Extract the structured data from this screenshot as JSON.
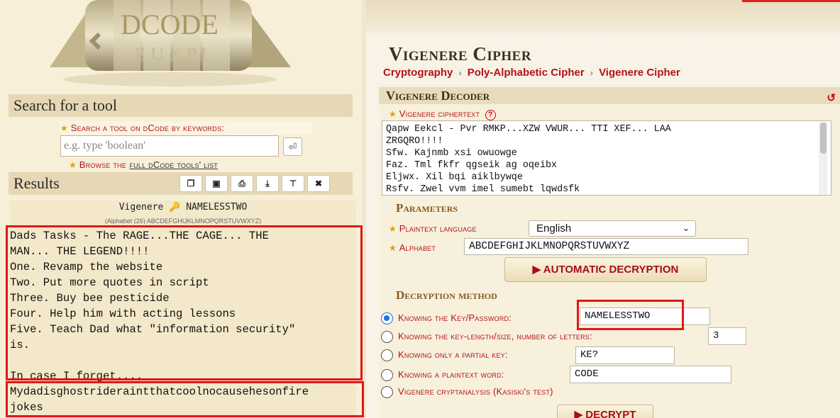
{
  "logo": {
    "text": "DCODE"
  },
  "search": {
    "heading": "Search for a tool",
    "label": "Search a tool on dCode by keywords:",
    "placeholder": "e.g. type 'boolean'",
    "browse_prefix": "Browse the",
    "browse_link": "full dCode tools' list"
  },
  "results": {
    "heading": "Results",
    "buttons": [
      "copy-icon",
      "save-icon",
      "print-icon",
      "download-icon",
      "pin-icon",
      "close-icon"
    ],
    "title_method": "Vigenere",
    "title_key": "NAMELESSTWO",
    "subtitle": "(Alphabet (26) ABCDEFGHIJKLMNOPQRSTUVWXYZ)",
    "text_lines": [
      "Dads Tasks - The RAGE...THE CAGE... THE",
      "MAN... THE LEGEND!!!!",
      "One. Revamp the website",
      "Two. Put more quotes in script",
      "Three. Buy bee pesticide",
      "Four. Help him with acting lessons",
      "Five. Teach Dad what \"information security\"",
      "is.",
      "",
      "In case I forget....",
      "Mydadisghostrideraintthatcoolnocausehesonfire",
      "jokes"
    ]
  },
  "page": {
    "title": "Vigenere Cipher",
    "breadcrumb": [
      "Cryptography",
      "Poly-Alphabetic Cipher",
      "Vigenere Cipher"
    ]
  },
  "decoder": {
    "heading": "Vigenere Decoder",
    "ciphertext_label": "Vigenere ciphertext",
    "ciphertext_lines": [
      "Qapw Eekcl - Pvr RMKP...XZW VWUR... TTI XEF... LAA",
      "ZRGQRO!!!!",
      "Sfw. Kajnmb xsi owuowge",
      "Faz. Tml fkfr qgseik ag oqeibx",
      "Eljwx. Xil bqi aiklbywqe",
      "Rsfv. Zwel vvm imel sumebt lqwdsfk"
    ],
    "parameters_heading": "Parameters",
    "plaintext_language_label": "Plaintext language",
    "plaintext_language_value": "English",
    "alphabet_label": "Alphabet",
    "alphabet_value": "ABCDEFGHIJKLMNOPQRSTUVWXYZ",
    "auto_button": "▶ AUTOMATIC DECRYPTION",
    "method_heading": "Decryption method",
    "methods": [
      {
        "label": "Knowing the Key/Password:",
        "value": "NAMELESSTWO",
        "selected": true
      },
      {
        "label": "Knowing the key-length/size, number of letters:",
        "value": "3",
        "selected": false
      },
      {
        "label": "Knowing only a partial key:",
        "value": "KE?",
        "selected": false
      },
      {
        "label": "Knowing a plaintext word:",
        "value": "CODE",
        "selected": false
      },
      {
        "label": "Vigenere cryptanalysis (Kasiski's test)",
        "value": null,
        "selected": false
      }
    ],
    "decrypt_button": "▶ DECRYPT"
  },
  "colors": {
    "accent_red": "#b5121b",
    "highlight_box": "#e01818",
    "radio_selected": "#1a73e8"
  }
}
